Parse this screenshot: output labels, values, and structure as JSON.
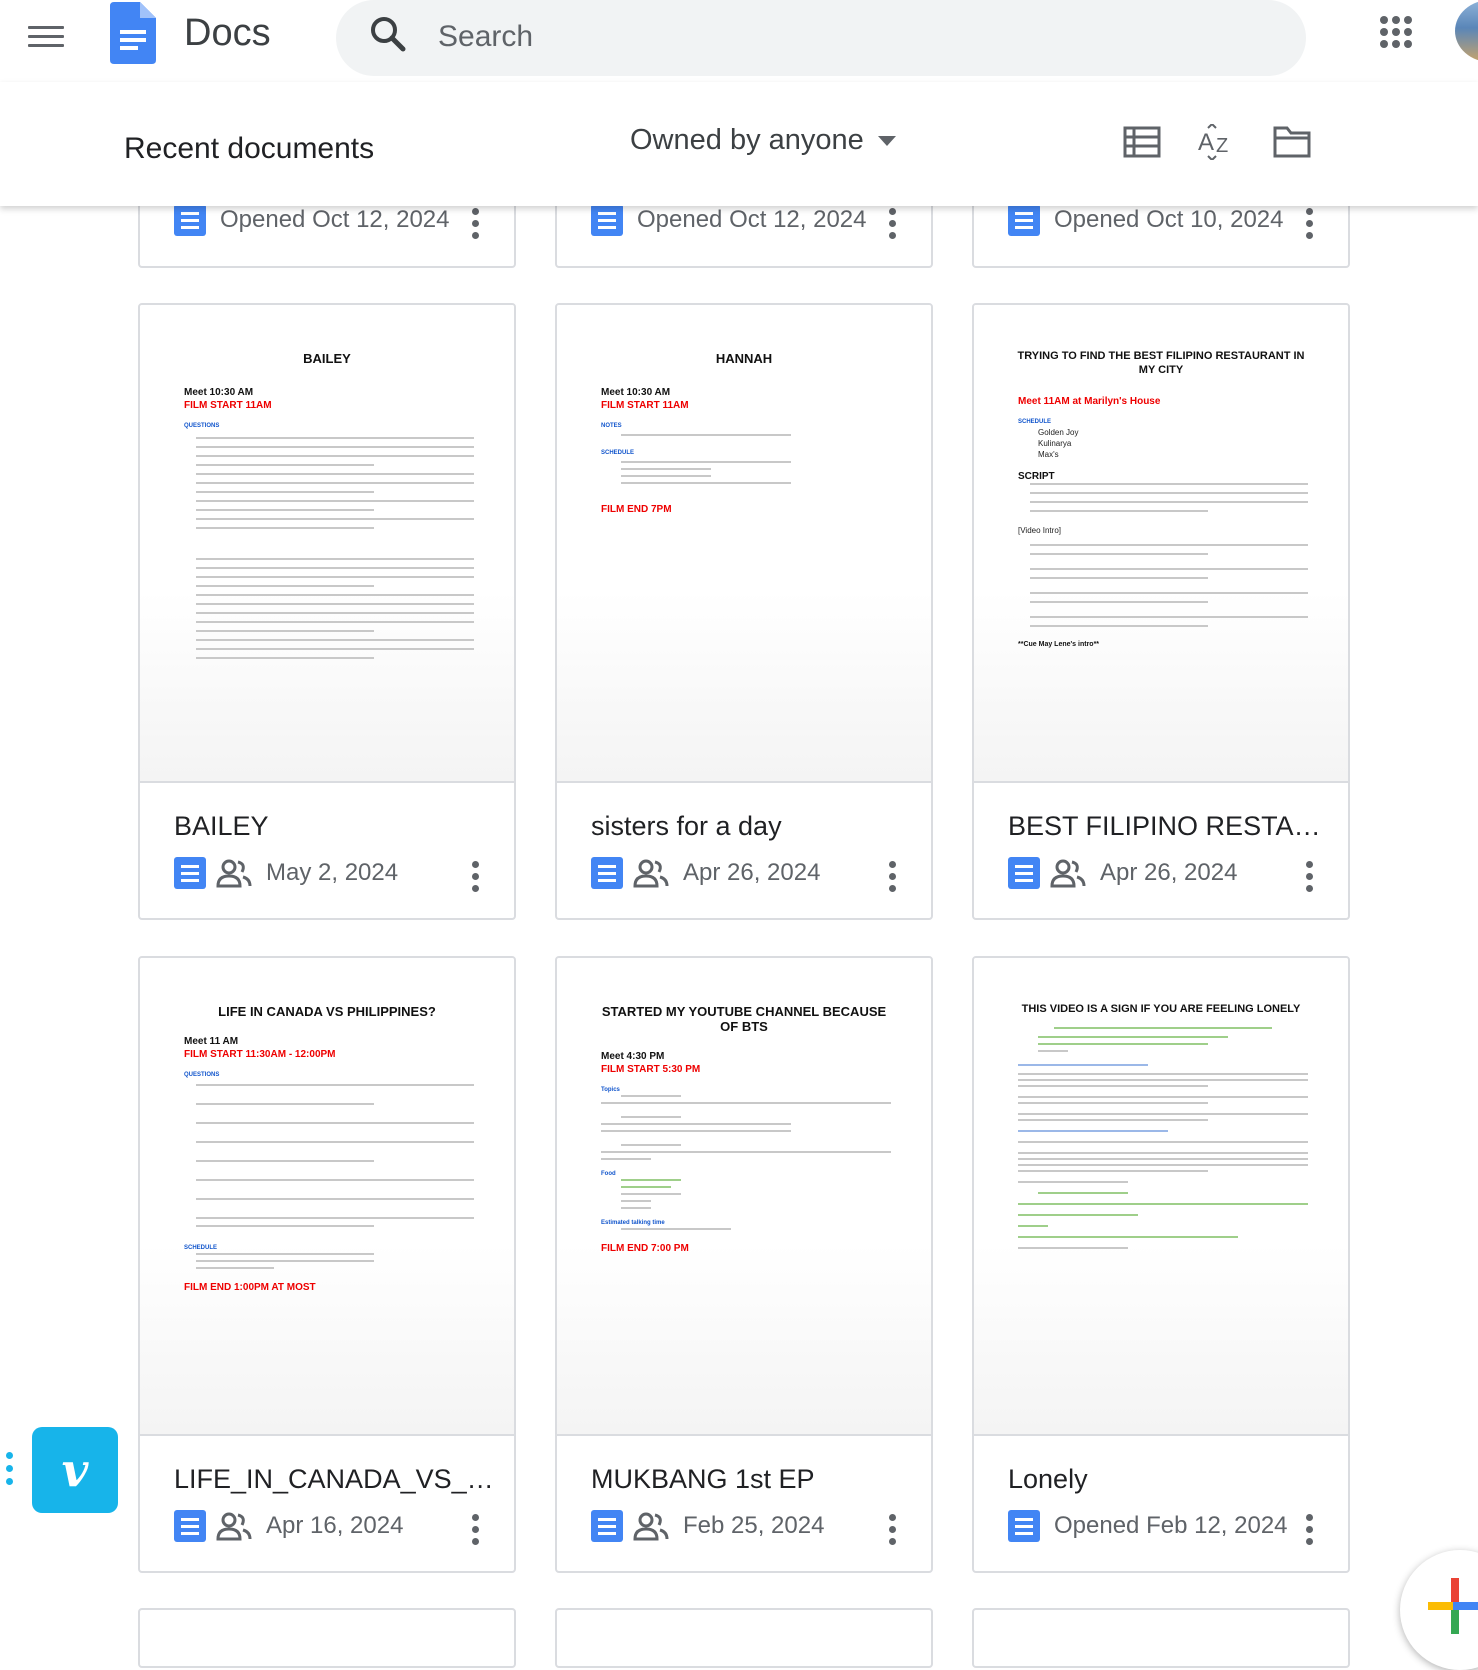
{
  "appbar": {
    "title": "Docs",
    "search_placeholder": "Search"
  },
  "subheader": {
    "section_title": "Recent documents",
    "owner_filter": "Owned by anyone"
  },
  "top_row": [
    {
      "date": "Opened Oct 12, 2024"
    },
    {
      "date": "Opened Oct 12, 2024"
    },
    {
      "date": "Opened Oct 10, 2024"
    }
  ],
  "cards": [
    {
      "title": "BAILEY",
      "date": "May 2, 2024",
      "shared": true,
      "preview": {
        "heading": "BAILEY",
        "meet": "Meet 10:30 AM",
        "film_start": "FILM START 11AM",
        "section": "QUESTIONS"
      }
    },
    {
      "title": "sisters for a day",
      "date": "Apr 26, 2024",
      "shared": true,
      "preview": {
        "heading": "HANNAH",
        "meet": "Meet 10:30 AM",
        "film_start": "FILM START 11AM",
        "notes": "NOTES",
        "schedule": "SCHEDULE",
        "film_end": "FILM END 7PM"
      }
    },
    {
      "title": "BEST FILIPINO RESTAUR...",
      "date": "Apr 26, 2024",
      "shared": true,
      "preview": {
        "heading": "TRYING TO FIND THE BEST FILIPINO RESTAURANT IN MY CITY",
        "meet": "Meet 11AM at Marilyn's House",
        "schedule": "SCHEDULE",
        "items": [
          "Golden Joy",
          "Kulinarya",
          "Max's"
        ],
        "script": "SCRIPT",
        "intro": "[Video Intro]",
        "cue": "**Cue May Lene's intro**"
      }
    },
    {
      "title": "LIFE_IN_CANADA_VS_PHI...",
      "date": "Apr 16, 2024",
      "shared": true,
      "preview": {
        "heading": "LIFE IN CANADA VS PHILIPPINES?",
        "meet": "Meet 11 AM",
        "film_start": "FILM START 11:30AM - 12:00PM",
        "section": "QUESTIONS",
        "schedule": "SCHEDULE",
        "film_end": "FILM END 1:00PM AT MOST"
      }
    },
    {
      "title": "MUKBANG 1st EP",
      "date": "Feb 25, 2024",
      "shared": true,
      "preview": {
        "heading": "STARTED MY YOUTUBE CHANNEL BECAUSE OF BTS",
        "meet": "Meet 4:30 PM",
        "film_start": "FILM START 5:30 PM",
        "topics": "Topics",
        "food": "Food",
        "talking": "Estimated talking time",
        "film_end": "FILM END 7:00 PM"
      }
    },
    {
      "title": "Lonely",
      "date": "Opened Feb 12, 2024",
      "shared": false,
      "preview": {
        "heading": "THIS VIDEO IS A SIGN IF YOU ARE FEELING LONELY"
      }
    }
  ],
  "colors": {
    "docs_blue": "#4285f4",
    "filter_text": "#3c4043",
    "vimeo": "#17b4ea"
  },
  "icons": {
    "menu": "hamburger-icon",
    "search": "magnifier-icon",
    "apps": "grid-dots-icon",
    "list_view": "list-view-icon",
    "sort": "sort-az-icon",
    "folder": "folder-icon",
    "more": "vertical-dots-icon",
    "shared": "people-icon",
    "new": "plus-icon"
  },
  "vimeo_letter": "v"
}
